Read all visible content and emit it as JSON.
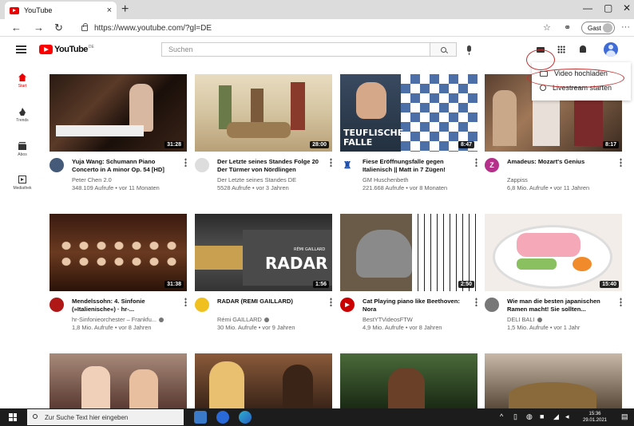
{
  "browser": {
    "tab_title": "YouTube",
    "tab_close": "×",
    "new_tab": "+",
    "url": "https://www.youtube.com/?gl=DE",
    "profile_label": "Gast",
    "win_minimize": "—",
    "win_maximize": "▢",
    "win_close": "✕",
    "more_menu": "···"
  },
  "header": {
    "logo_word": "YouTube",
    "logo_region": "DE",
    "search_placeholder": "Suchen"
  },
  "upload_menu": {
    "items": [
      {
        "label": "Video hochladen"
      },
      {
        "label": "Livestream starten"
      }
    ]
  },
  "sidebar": {
    "items": [
      {
        "label": "Start"
      },
      {
        "label": "Trends"
      },
      {
        "label": "Abos"
      },
      {
        "label": "Mediathek"
      }
    ]
  },
  "videos": [
    {
      "title": "Yuja Wang: Schumann Piano Concerto in A minor Op. 54 [HD]",
      "channel": "Peter Chen 2.0",
      "stats": "348.109 Aufrufe • vor 11 Monaten",
      "duration": "31:28"
    },
    {
      "title": "Der Letzte seines Standes Folge 20 Der Türmer von Nördlingen",
      "channel": "Der Letzte seines Standes DE",
      "stats": "5528 Aufrufe • vor 3 Jahren",
      "duration": "28:00"
    },
    {
      "title": "Fiese Eröffnungsfalle gegen Italienisch || Matt in 7 Zügen!",
      "channel": "GM Huschenbeth",
      "stats": "221.668 Aufrufe • vor 8 Monaten",
      "duration": "8:47",
      "thumb_text": "TEUFLISCHE FALLE"
    },
    {
      "title": "Amadeus: Mozart's Genius",
      "channel": "Zappiss",
      "stats": "6,8 Mio. Aufrufe • vor 11 Jahren",
      "duration": "8:17"
    },
    {
      "title": "Mendelssohn: 4. Sinfonie (»Italienische«) · hr-...",
      "channel": "hr-Sinfonieorchester – Frankfu...",
      "stats": "1,8 Mio. Aufrufe • vor 8 Jahren",
      "duration": "31:38"
    },
    {
      "title": "RADAR (REMI GAILLARD)",
      "channel": "Rémi GAILLARD",
      "stats": "30 Mio. Aufrufe • vor 9 Jahren",
      "duration": "1:56",
      "thumb_text": "RADAR",
      "thumb_small": "RÉMI GAILLARD"
    },
    {
      "title": "Cat Playing piano like Beethoven: Nora",
      "channel": "BestYTVideosFTW",
      "stats": "4,9 Mio. Aufrufe • vor 8 Jahren",
      "duration": "2:50"
    },
    {
      "title": "Wie man die besten japanischen Ramen macht! Sie sollten...",
      "channel": "DELI BALI",
      "stats": "1,5 Mio. Aufrufe • vor 1 Jahr",
      "duration": "15:40"
    }
  ],
  "taskbar": {
    "search_placeholder": "Zur Suche Text hier eingeben",
    "time": "15:36",
    "date": "29.01.2021"
  }
}
